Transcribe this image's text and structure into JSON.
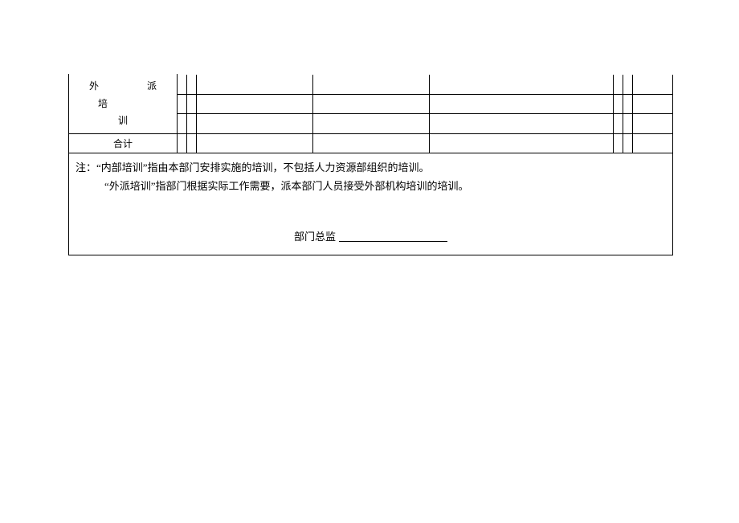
{
  "section": {
    "wai": "外",
    "pai": "派",
    "pei": "培",
    "xun": "训"
  },
  "total_label": "合计",
  "notes": {
    "line1": "注：“内部培训”指由本部门安排实施的培训，不包括人力资源部组织的培训。",
    "line2": "“外派培训”指部门根据实际工作需要，派本部门人员接受外部机构培训的培训。"
  },
  "signature_label": "部门总监"
}
